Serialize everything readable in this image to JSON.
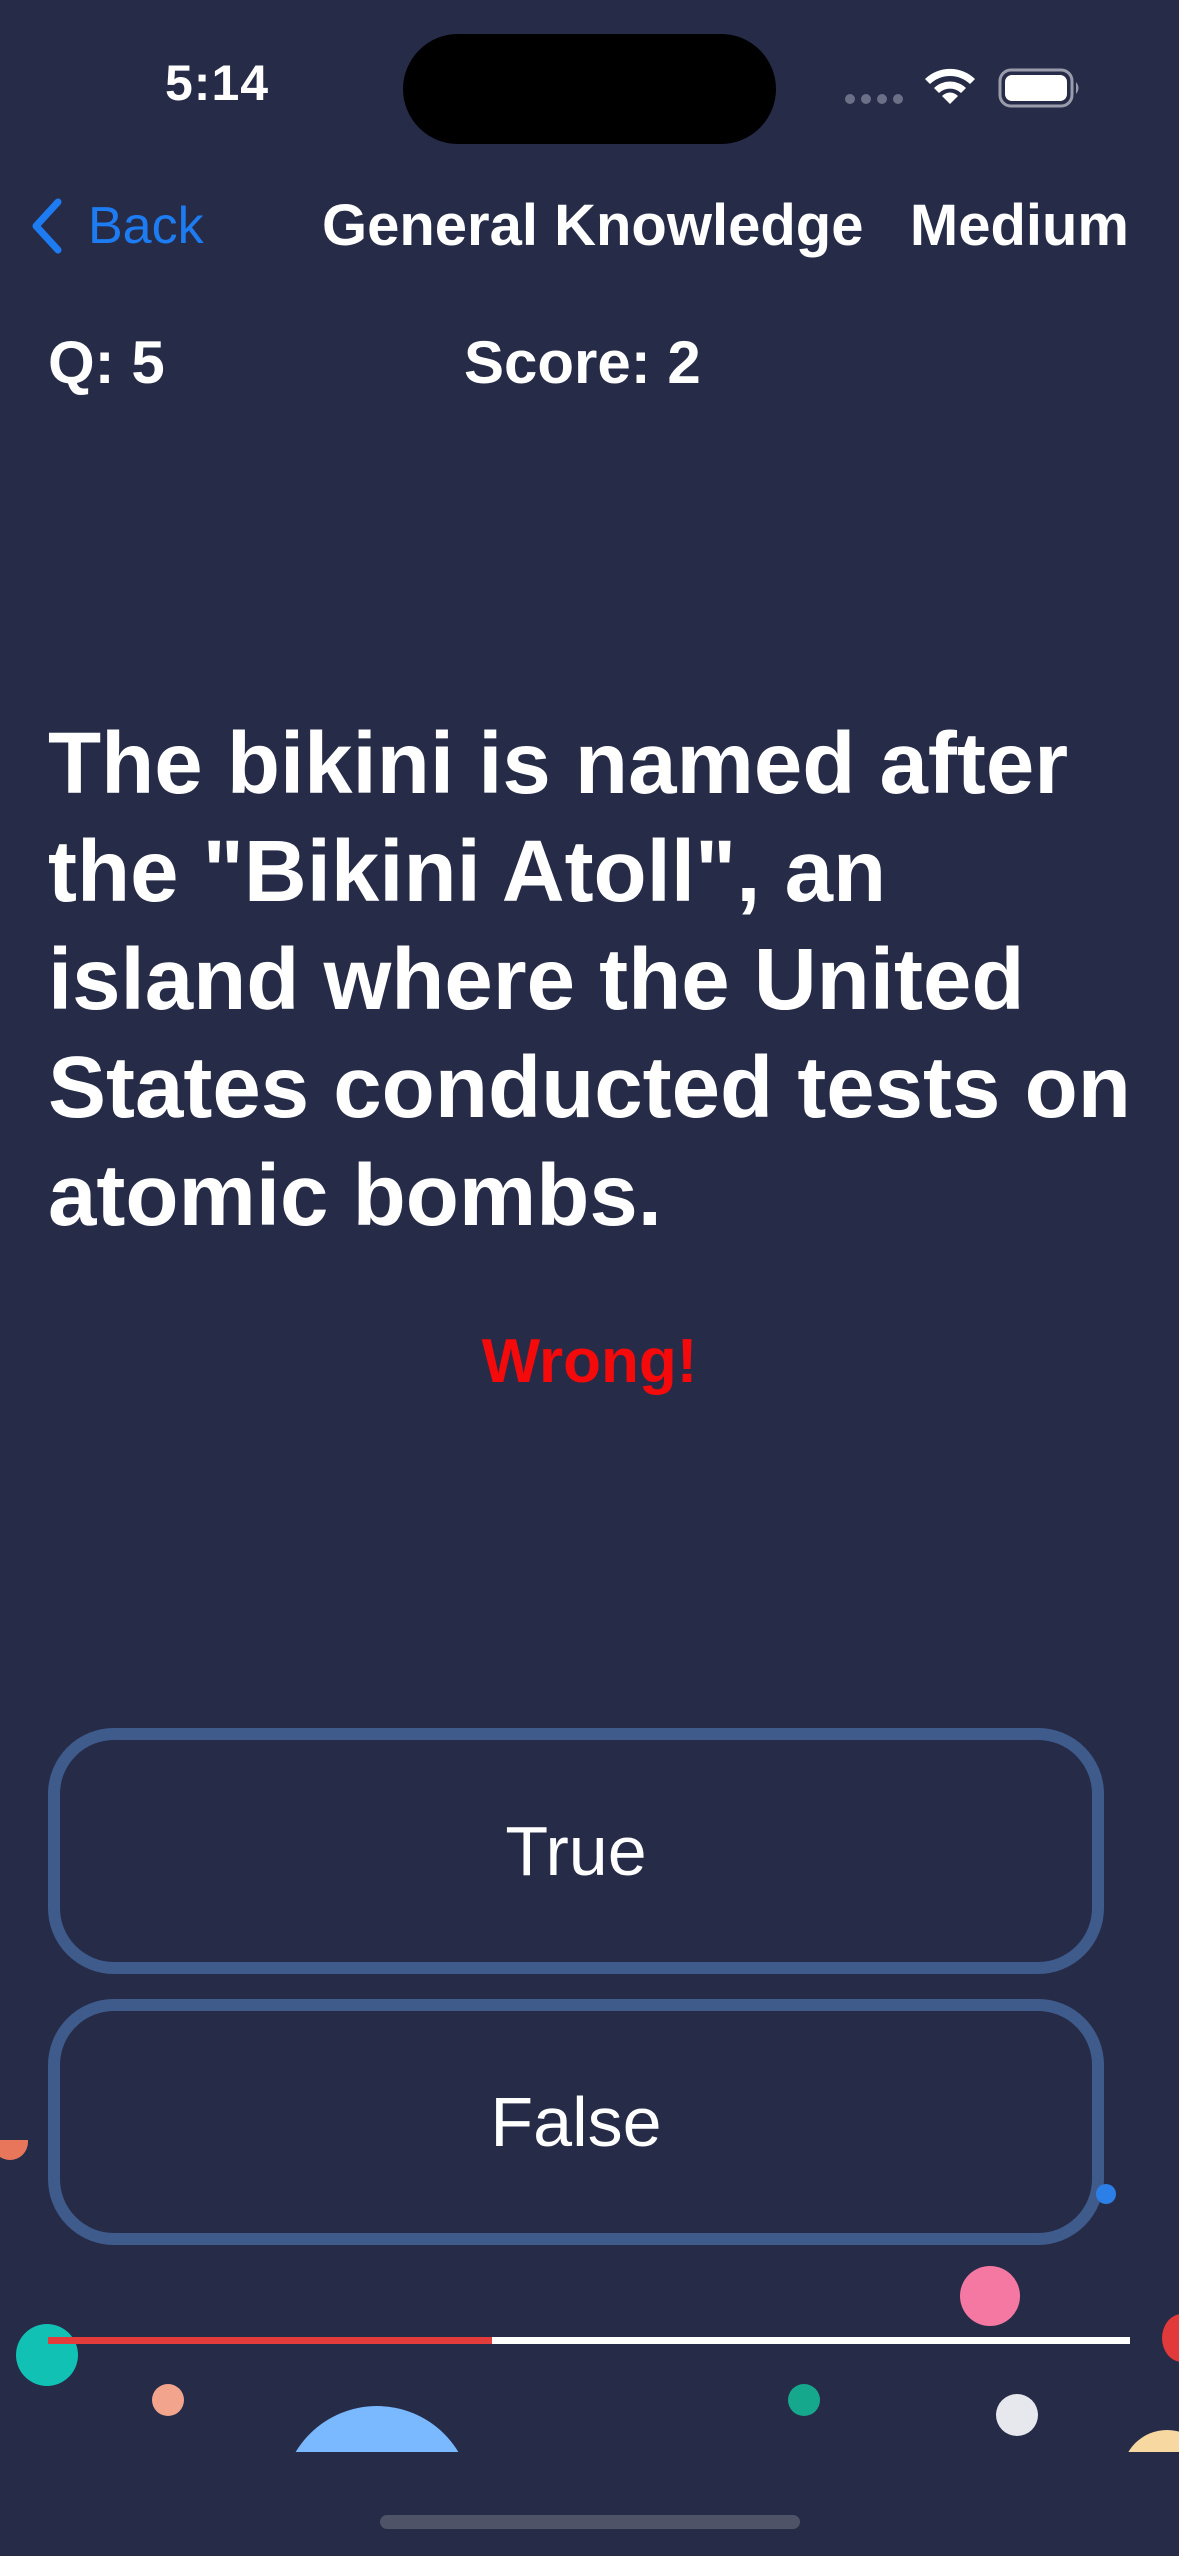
{
  "status_bar": {
    "time": "5:14"
  },
  "nav": {
    "back_label": "Back",
    "title": "General Knowledge",
    "difficulty": "Medium"
  },
  "quiz": {
    "question_number_label": "Q: 5",
    "score_label": "Score: 2",
    "question": "The bikini is named after the \"Bikini Atoll\", an island where the United States conducted tests on atomic bombs.",
    "feedback": "Wrong!",
    "answers": [
      {
        "label": "True"
      },
      {
        "label": "False"
      }
    ],
    "progress_fraction": 0.41
  },
  "colors": {
    "background": "#262b48",
    "accent_blue": "#1e7cf2",
    "wrong_red": "#f40a0a",
    "button_border": "#3f5b8c",
    "progress_fill": "#e43c3a"
  },
  "icons": {
    "back": "chevron-left-icon",
    "wifi": "wifi-icon",
    "battery": "battery-icon",
    "signal": "cellular-signal-icon"
  }
}
